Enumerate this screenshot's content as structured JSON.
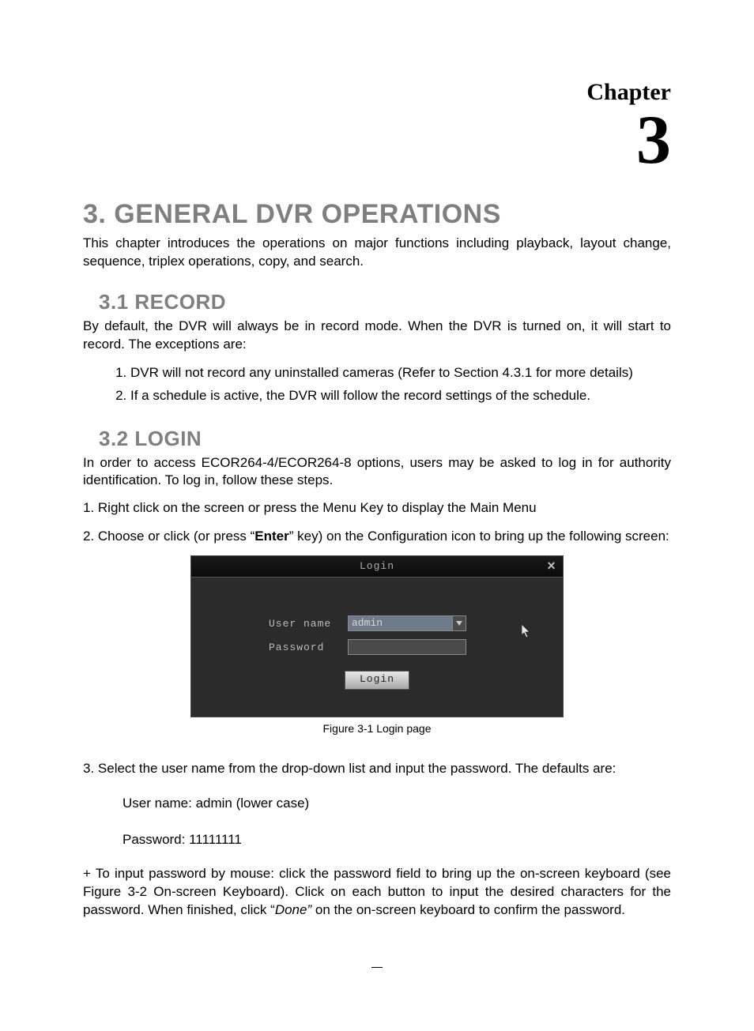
{
  "chapter": {
    "label": "Chapter",
    "number": "3"
  },
  "title": "3. GENERAL DVR OPERATIONS",
  "intro_para": "This chapter introduces the operations on major functions including playback, layout change, sequence, triplex operations, copy, and search.",
  "section_1": {
    "heading": "3.1  RECORD",
    "para": "By default, the DVR will always be in record mode. When the DVR is turned on, it will start to record. The exceptions are:",
    "list": [
      "DVR will not record any uninstalled cameras (Refer to Section 4.3.1 for more details)",
      "If a schedule is active, the DVR will follow the record settings of the schedule."
    ]
  },
  "section_2": {
    "heading": "3.2  LOGIN",
    "para": "In order to access ECOR264-4/ECOR264-8 options, users may be asked to log in for authority identification. To log in, follow these steps.",
    "step1": "1. Right click on the screen or press the Menu Key to display the Main Menu",
    "step2_pre": "2. Choose or click (or press “",
    "step2_bold": "Enter",
    "step2_post": "” key) on the Configuration icon to bring up the following screen:",
    "caption": "Figure 3-1 Login page",
    "step3": "3. Select the user name from the drop-down list and input the password. The defaults are:",
    "defaults": {
      "username": "User name: admin (lower case)",
      "password": "Password: 11111111"
    },
    "step4_pre": "+ To input password by mouse: click the password field to bring up the on-screen keyboard (see Figure 3-2 On-screen Keyboard). Click on each button to input the desired characters for the password. When finished, click “",
    "step4_italic": "Done”",
    "step4_post": " on the on-screen keyboard to confirm the password."
  },
  "login_dialog": {
    "title": "Login",
    "username_label": "User name",
    "username_value": "admin",
    "password_label": "Password",
    "password_value": "",
    "button": "Login"
  }
}
